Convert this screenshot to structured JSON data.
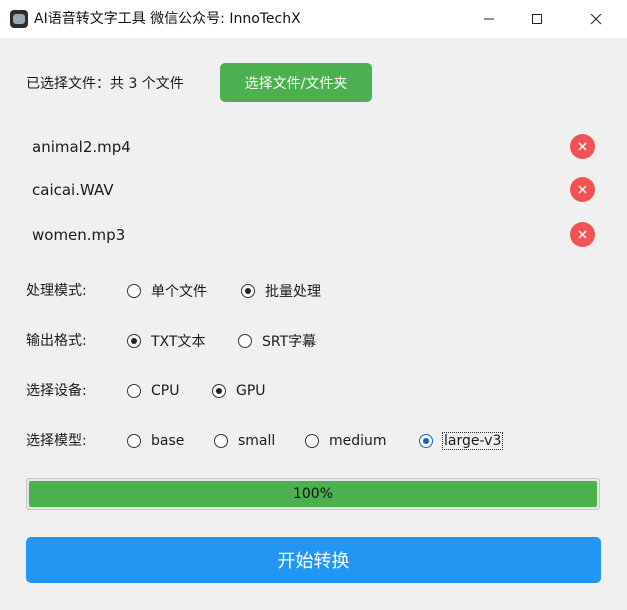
{
  "window": {
    "title": "AI语音转文字工具  微信公众号: InnoTechX",
    "icon": "app-icon"
  },
  "files": {
    "summary": "已选择文件：共 3 个文件",
    "pick_button": "选择文件/文件夹",
    "items": [
      {
        "name": "animal2.mp4"
      },
      {
        "name": "caicai.WAV"
      },
      {
        "name": "women.mp3"
      }
    ]
  },
  "options": {
    "mode": {
      "label": "处理模式:",
      "choices": [
        "单个文件",
        "批量处理"
      ],
      "selected": "批量处理"
    },
    "format": {
      "label": "输出格式:",
      "choices": [
        "TXT文本",
        "SRT字幕"
      ],
      "selected": "TXT文本"
    },
    "device": {
      "label": "选择设备:",
      "choices": [
        "CPU",
        "GPU"
      ],
      "selected": "GPU"
    },
    "model": {
      "label": "选择模型:",
      "choices": [
        "base",
        "small",
        "medium",
        "large-v3"
      ],
      "selected": "large-v3"
    }
  },
  "progress": {
    "value": 100,
    "text": "100%"
  },
  "start_button": "开始转换",
  "colors": {
    "green": "#4caf50",
    "blue": "#2196f3",
    "remove_red": "#f05353"
  }
}
